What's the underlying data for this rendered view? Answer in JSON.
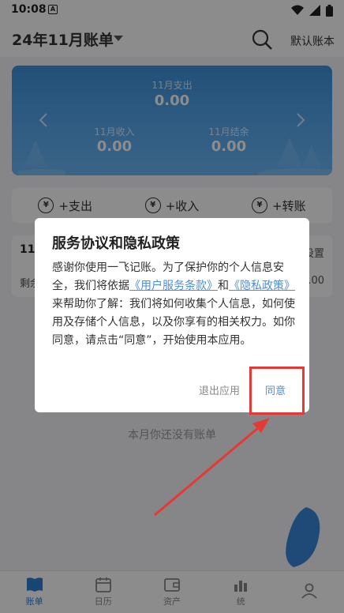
{
  "status_bar": {
    "time": "10:08",
    "notification_letter": "A"
  },
  "header": {
    "title": "24年11月账单",
    "book_label": "默认账本"
  },
  "summary": {
    "expense_label": "11月支出",
    "expense_value": "0.00",
    "income_label": "11月收入",
    "income_value": "0.00",
    "balance_label": "11月结余",
    "balance_value": "0.00"
  },
  "actions": [
    {
      "label": "+支出",
      "icon": "¥"
    },
    {
      "label": "+收入",
      "icon": "¥"
    },
    {
      "label": "+转账",
      "icon": "¥"
    }
  ],
  "budget": {
    "title": "11",
    "setting": "设置",
    "remain": "剩余",
    "value": ".00"
  },
  "empty_text": "本月你还没有账单",
  "nav": [
    {
      "label": "账单",
      "icon": "book-icon"
    },
    {
      "label": "日历",
      "icon": "calendar-icon"
    },
    {
      "label": "资产",
      "icon": "wallet-icon"
    },
    {
      "label": "统",
      "icon": "chart-icon"
    },
    {
      "label": "",
      "icon": "user-icon"
    }
  ],
  "dialog": {
    "title": "服务协议和隐私政策",
    "body_1": "感谢你使用一飞记账。为了保护你的个人信息安全，我们将依据",
    "link_terms": "《用户服务条款》",
    "body_2": "和",
    "link_privacy": "《隐私政策》",
    "body_3": "来帮助你了解：我们将如何收集个人信息，如何使用及存储个人信息，以及你享有的相关权力。如你同意，请点击“同意”，开始使用本应用。",
    "exit_label": "退出应用",
    "agree_label": "同意"
  },
  "colors": {
    "accent": "#4a8fd8",
    "card": "#4f9fe8",
    "highlight": "#e53935"
  }
}
